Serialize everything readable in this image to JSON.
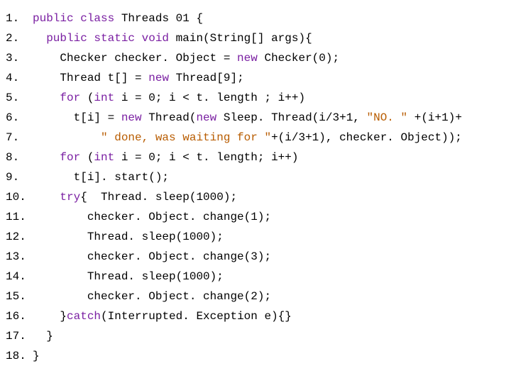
{
  "lines": {
    "n1": "1.",
    "n2": "2.",
    "n3": "3.",
    "n4": "4.",
    "n5": "5.",
    "n6": "6.",
    "n7": "7.",
    "n8": "8.",
    "n9": "9.",
    "n10": "10.",
    "n11": "11.",
    "n12": "12.",
    "n13": "13.",
    "n14": "14.",
    "n15": "15.",
    "n16": "16.",
    "n17": "17.",
    "n18": "18."
  },
  "t": {
    "l1_1": "public class ",
    "l1_2": "Threads 01 {",
    "l2_1": "  public static void ",
    "l2_2": "main(String[] args){",
    "l3_1": "    Checker checker. Object = ",
    "l3_2": "new",
    "l3_3": " Checker(0);",
    "l4_1": "    Thread t[] = ",
    "l4_2": "new",
    "l4_3": " Thread[9];",
    "l5_1": "    ",
    "l5_2": "for",
    "l5_3": " (",
    "l5_4": "int",
    "l5_5": " i = 0; i < t. length ; i++)",
    "l6_1": "      t[i] = ",
    "l6_2": "new",
    "l6_3": " Thread(",
    "l6_4": "new",
    "l6_5": " Sleep. Thread(i/3+1, ",
    "l6_6": "\"NO. \"",
    "l6_7": " +(i+1)+",
    "l7_1": "          ",
    "l7_2": "\" done, was waiting for \"",
    "l7_3": "+(i/3+1), checker. Object));",
    "l8_1": "    ",
    "l8_2": "for",
    "l8_3": " (",
    "l8_4": "int",
    "l8_5": " i = 0; i < t. length; i++)",
    "l9_1": "      t[i]. start();",
    "l10_1": "    ",
    "l10_2": "try",
    "l10_3": "{  Thread. sleep(1000);",
    "l11_1": "        checker. Object. change(1);",
    "l12_1": "        Thread. sleep(1000);",
    "l13_1": "        checker. Object. change(3);",
    "l14_1": "        Thread. sleep(1000);",
    "l15_1": "        checker. Object. change(2);",
    "l16_1": "    }",
    "l16_2": "catch",
    "l16_3": "(Interrupted. Exception e){}",
    "l17_1": "  }",
    "l18_1": "}"
  }
}
